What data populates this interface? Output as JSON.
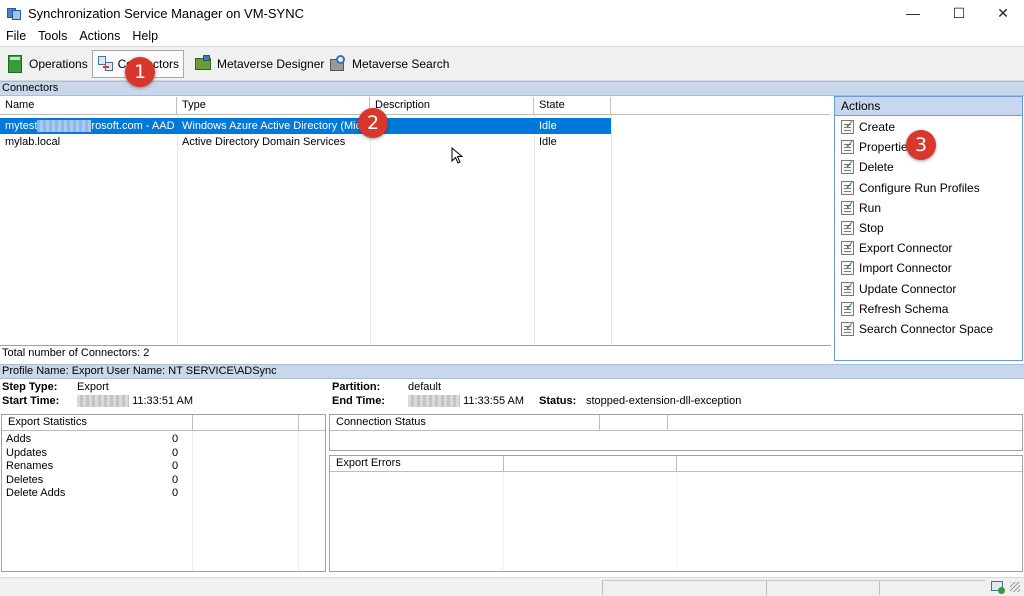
{
  "window": {
    "title": "Synchronization Service Manager on VM-SYNC",
    "minimize": "—",
    "maximize": "☐",
    "close": "✕"
  },
  "menu": [
    "File",
    "Tools",
    "Actions",
    "Help"
  ],
  "toolbar": {
    "operations": "Operations",
    "connectors": "Connectors",
    "metaverse_designer": "Metaverse Designer",
    "metaverse_search": "Metaverse Search"
  },
  "connectors_section": "Connectors",
  "columns": [
    "Name",
    "Type",
    "Description",
    "State"
  ],
  "rows": [
    {
      "name_prefix": "mytest",
      "name_suffix": "rosoft.com - AAD",
      "type": "Windows Azure Active Directory (Micr",
      "description": "",
      "state": "Idle"
    },
    {
      "name_prefix": "mylab.local",
      "name_suffix": "",
      "type": "Active Directory Domain Services",
      "description": "",
      "state": "Idle"
    }
  ],
  "total_connectors": "Total number of Connectors: 2",
  "actions": {
    "header": "Actions",
    "items": [
      "Create",
      "Properties",
      "Delete",
      "Configure Run Profiles",
      "Run",
      "Stop",
      "Export Connector",
      "Import Connector",
      "Update Connector",
      "Refresh Schema",
      "Search Connector Space"
    ]
  },
  "profile_bar": "Profile Name: Export  User Name: NT SERVICE\\ADSync",
  "run_info": {
    "step_type_label": "Step Type:",
    "step_type": "Export",
    "start_time_label": "Start Time:",
    "start_time": "11:33:51 AM",
    "partition_label": "Partition:",
    "partition": "default",
    "end_time_label": "End Time:",
    "end_time": "11:33:55 AM",
    "status_label": "Status:",
    "status": "stopped-extension-dll-exception"
  },
  "export_statistics": {
    "header": "Export Statistics",
    "rows": [
      {
        "label": "Adds",
        "value": "0"
      },
      {
        "label": "Updates",
        "value": "0"
      },
      {
        "label": "Renames",
        "value": "0"
      },
      {
        "label": "Deletes",
        "value": "0"
      },
      {
        "label": "Delete Adds",
        "value": "0"
      }
    ]
  },
  "connection_status": "Connection Status",
  "export_errors": "Export Errors",
  "callouts": [
    "1",
    "2",
    "3"
  ],
  "colors": {
    "selection": "#0078d7",
    "section_bar": "#c9d7ea",
    "callout": "#d9372b"
  }
}
